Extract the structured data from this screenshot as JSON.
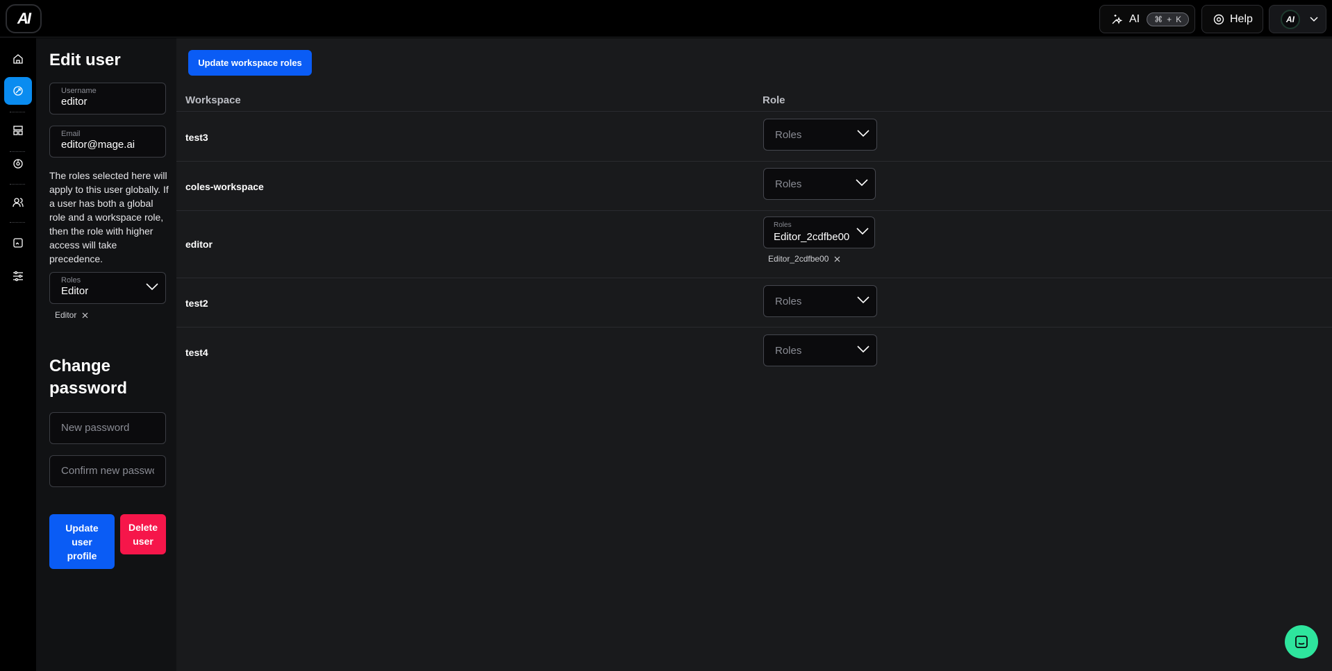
{
  "topbar": {
    "logo_text": "AI",
    "ai_label": "AI",
    "ai_kbd_cmd": "⌘",
    "ai_kbd_plus": "+",
    "ai_kbd_key": "K",
    "help_label": "Help",
    "avatar_text": "AI"
  },
  "rail": {
    "items": [
      "home-icon",
      "pipelines-icon",
      "templates-icon",
      "monitor-icon",
      "users-icon",
      "files-icon",
      "settings-icon"
    ]
  },
  "side": {
    "title": "Edit user",
    "username_label": "Username",
    "username_value": "editor",
    "email_label": "Email",
    "email_value": "editor@mage.ai",
    "note": "The roles selected here will apply to this user globally. If a user has both a global role and a workspace role, then the role with higher access will take precedence.",
    "roles_label": "Roles",
    "roles_value": "Editor",
    "role_chip": "Editor",
    "password_title": "Change password",
    "new_password_placeholder": "New password",
    "confirm_password_placeholder": "Confirm new password",
    "update_button": "Update user profile",
    "delete_button": "Delete user"
  },
  "main": {
    "update_button": "Update workspace roles",
    "col_workspace": "Workspace",
    "col_role": "Role",
    "rows": [
      {
        "workspace": "test3",
        "placeholder": "Roles"
      },
      {
        "workspace": "coles-workspace",
        "placeholder": "Roles"
      },
      {
        "workspace": "editor",
        "label": "Roles",
        "value": "Editor_2cdfbe00",
        "chip": "Editor_2cdfbe00"
      },
      {
        "workspace": "test2",
        "placeholder": "Roles"
      },
      {
        "workspace": "test4",
        "placeholder": "Roles"
      }
    ]
  },
  "colors": {
    "accent_blue": "#0a5cf5",
    "active_rail": "#0a8cf0",
    "danger": "#f6164a",
    "chat": "#2ee59d"
  }
}
